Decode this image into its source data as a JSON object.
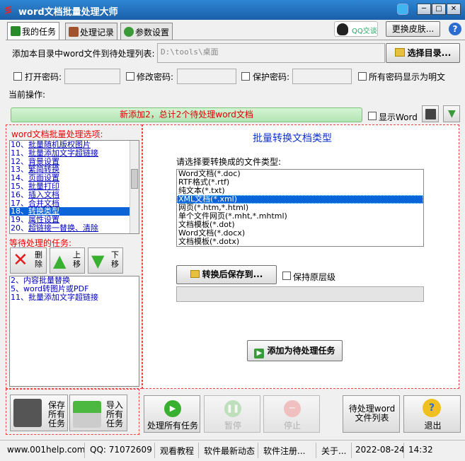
{
  "window": {
    "title": "word文档批量处理大师",
    "min_label": "─",
    "max_label": "□",
    "close_label": "✕"
  },
  "tabs": [
    {
      "label": "我的任务"
    },
    {
      "label": "处理记录"
    },
    {
      "label": "参数设置"
    }
  ],
  "header": {
    "qq_label": "QQ交谈",
    "skin_button": "更换皮肤...",
    "help_label": "?"
  },
  "form": {
    "dir_label": "添加本目录中word文件到待处理列表:",
    "dir_value": "D:\\tools\\桌面",
    "choose_dir_button": "选择目录...",
    "open_password_label": "打开密码:",
    "modify_password_label": "修改密码:",
    "protect_password_label": "保护密码:",
    "show_plain_label": "所有密码显示为明文",
    "current_op_label": "当前操作:",
    "status_text": "新添加2，总计2个待处理word文档",
    "show_word_label": "显示Word"
  },
  "options": {
    "title": "word文档批量处理选项:",
    "items": [
      {
        "num": "10、",
        "text": "批量随机版权图片"
      },
      {
        "num": "11、",
        "text": "批量添加文字超链接"
      },
      {
        "num": "12、",
        "text": "背景设置"
      },
      {
        "num": "13、",
        "text": "繁简转换"
      },
      {
        "num": "14、",
        "text": "页面设置"
      },
      {
        "num": "15、",
        "text": "批量打印"
      },
      {
        "num": "16、",
        "text": "插入文档"
      },
      {
        "num": "17、",
        "text": "合并文档"
      },
      {
        "num": "18、",
        "text": "转换类型"
      },
      {
        "num": "19、",
        "text": "属性设置"
      },
      {
        "num": "20、",
        "text": "超链接一替换、清除"
      }
    ],
    "selected_index": 8
  },
  "pending": {
    "title": "等待处理的任务:",
    "delete_label": "删除",
    "up_label": "上移",
    "down_label": "下移",
    "items": [
      {
        "num": "2、",
        "text": "内容批量替换"
      },
      {
        "num": "5、",
        "text": "word转图片或PDF"
      },
      {
        "num": "11、",
        "text": "批量添加文字超链接"
      }
    ]
  },
  "convert": {
    "title": "批量转换文档类型",
    "prompt": "请选择要转换成的文件类型:",
    "types": [
      "Word文档(*.doc)",
      "RTF格式(*.rtf)",
      "纯文本(*.txt)",
      "XML文档(*.xml)",
      "网页(*.htm,*.html)",
      "单个文件网页(*.mht,*.mhtml)",
      "文档模板(*.dot)",
      "Word文档(*.docx)",
      "文档模板(*.dotx)"
    ],
    "selected_index": 3,
    "save_to_button": "转换后保存到...",
    "keep_levels_label": "保持原层级",
    "add_task_button": "添加为待处理任务"
  },
  "bottom": {
    "save_all": "保存所有任务",
    "import_all": "导入所有任务",
    "process_all": "处理所有任务",
    "pause": "暂停",
    "stop": "停止",
    "save_list": "待处理word文件列表",
    "exit": "退出"
  },
  "footer": {
    "site": "www.001help.com",
    "qq": "QQ:  71072609",
    "tutorial": "观看教程",
    "news": "软件最新动态",
    "register": "软件注册...",
    "about": "关于...",
    "date": "2022-08-24",
    "time": "14:32"
  }
}
